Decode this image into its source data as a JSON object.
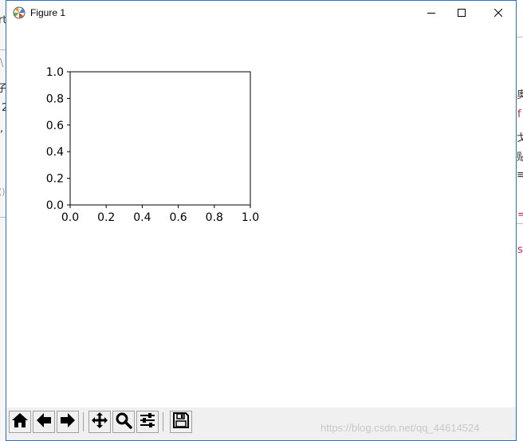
{
  "window": {
    "title": "Figure 1",
    "icon": "matplotlib-icon",
    "controls": [
      "minimize-icon",
      "maximize-icon",
      "close-icon"
    ]
  },
  "chart_data": {
    "type": "line",
    "title": "",
    "xlabel": "",
    "ylabel": "",
    "xlim": [
      0.0,
      1.0
    ],
    "ylim": [
      0.0,
      1.0
    ],
    "x_ticks": [
      "0.0",
      "0.2",
      "0.4",
      "0.6",
      "0.8",
      "1.0"
    ],
    "y_ticks": [
      "0.0",
      "0.2",
      "0.4",
      "0.6",
      "0.8",
      "1.0"
    ],
    "series": [],
    "grid": false
  },
  "toolbar": {
    "buttons": [
      "home-icon",
      "back-icon",
      "forward-icon",
      "pan-icon",
      "zoom-icon",
      "configure-subplots-icon",
      "save-icon"
    ],
    "watermark": "https://blog.csdn.net/qq_44614524"
  },
  "background_fragments": {
    "left": [
      "rt",
      "\\",
      "子",
      "2",
      ",",
      "()"
    ],
    "right": [
      "奥",
      "f",
      "戈",
      "贴",
      "≡",
      "=",
      "s"
    ]
  }
}
